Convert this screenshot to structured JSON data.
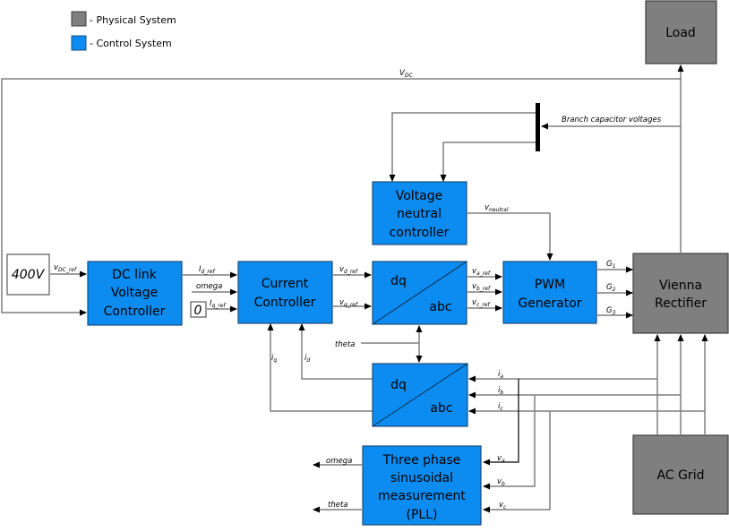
{
  "legend": [
    {
      "label": "- Physical System",
      "color": "#7f7f7f"
    },
    {
      "label": "- Control  System",
      "color": "#0c8cf0"
    }
  ],
  "blocks": {
    "load": {
      "lines": [
        "Load"
      ],
      "type": "physical"
    },
    "vienna": {
      "lines": [
        "Vienna",
        "Rectifier"
      ],
      "type": "physical"
    },
    "grid": {
      "lines": [
        "AC Grid"
      ],
      "type": "physical"
    },
    "vref": {
      "lines": [
        "400V"
      ],
      "type": "constant"
    },
    "zero": {
      "lines": [
        "0"
      ],
      "type": "constant"
    },
    "dclink": {
      "lines": [
        "DC link",
        "Voltage",
        "Controller"
      ],
      "type": "control"
    },
    "current": {
      "lines": [
        "Current",
        "Controller"
      ],
      "type": "control"
    },
    "dqabc1": {
      "top": "dq",
      "bottom": "abc",
      "type": "control"
    },
    "dqabc2": {
      "top": "dq",
      "bottom": "abc",
      "type": "control"
    },
    "pwm": {
      "lines": [
        "PWM",
        "Generator"
      ],
      "type": "control"
    },
    "neutral": {
      "lines": [
        "Voltage",
        "neutral",
        "controller"
      ],
      "type": "control"
    },
    "pll": {
      "lines": [
        "Three phase",
        "sinusoidal",
        "measurement",
        "(PLL)"
      ],
      "type": "control"
    }
  },
  "signals": {
    "vdc": {
      "main": "V",
      "sub": "DC"
    },
    "vdc_ref": {
      "main": "v",
      "sub": "DC_ref"
    },
    "id_ref": {
      "main": "I",
      "sub": "d_ref"
    },
    "omega_in": {
      "main": "omega",
      "sub": ""
    },
    "iq_ref": {
      "main": "I",
      "sub": "q_ref"
    },
    "vd_ref": {
      "main": "v",
      "sub": "d_ref"
    },
    "vq_ref": {
      "main": "v",
      "sub": "q_ref"
    },
    "va_ref": {
      "main": "v",
      "sub": "a_ref"
    },
    "vb_ref": {
      "main": "v",
      "sub": "b_ref"
    },
    "vc_ref": {
      "main": "v",
      "sub": "c_ref"
    },
    "g1": {
      "main": "G",
      "sub": "1"
    },
    "g2": {
      "main": "G",
      "sub": "2"
    },
    "g3": {
      "main": "G",
      "sub": "3"
    },
    "vneutral": {
      "main": "v",
      "sub": "neutral"
    },
    "branch": {
      "main": "Branch capacitor voltages",
      "sub": ""
    },
    "theta_in": {
      "main": "theta",
      "sub": ""
    },
    "iq": {
      "main": "i",
      "sub": "q"
    },
    "id": {
      "main": "i",
      "sub": "d"
    },
    "ia": {
      "main": "i",
      "sub": "a"
    },
    "ib": {
      "main": "i",
      "sub": "b"
    },
    "ic": {
      "main": "i",
      "sub": "c"
    },
    "va": {
      "main": "v",
      "sub": "a"
    },
    "vb": {
      "main": "v",
      "sub": "b"
    },
    "vc": {
      "main": "v",
      "sub": "c"
    },
    "omega_out": {
      "main": "omega",
      "sub": ""
    },
    "theta_out": {
      "main": "theta",
      "sub": ""
    }
  }
}
